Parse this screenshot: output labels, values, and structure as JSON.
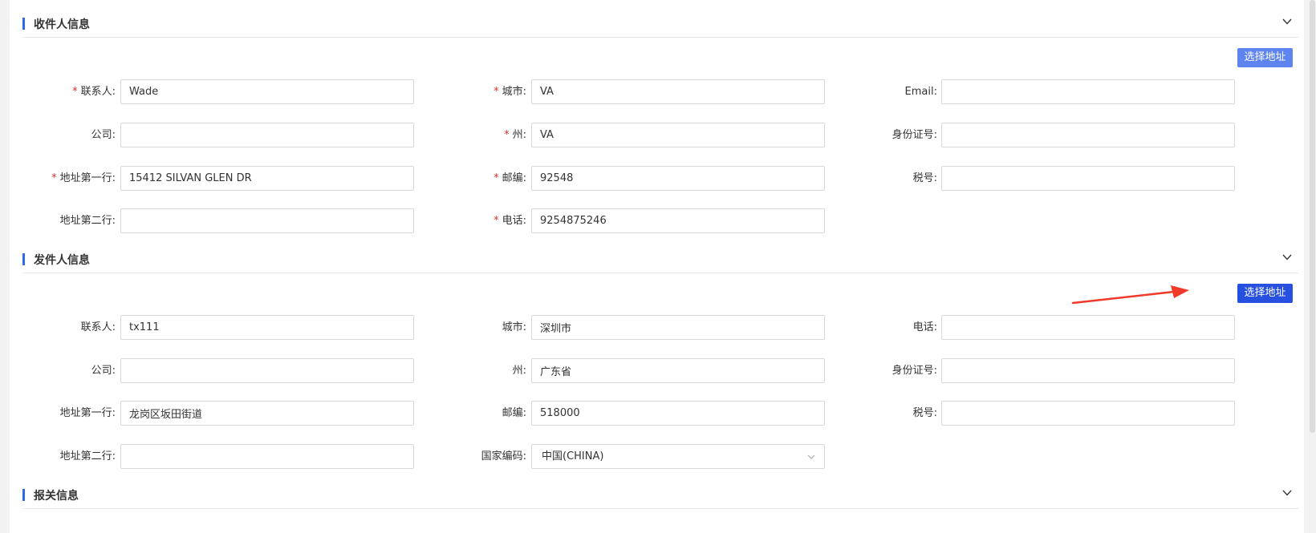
{
  "recipient": {
    "title": "收件人信息",
    "select_button": "选择地址",
    "fields": {
      "contact": {
        "label": "联系人",
        "value": "Wade",
        "required": true
      },
      "company": {
        "label": "公司",
        "value": "",
        "required": false
      },
      "address1": {
        "label": "地址第一行",
        "value": "15412 SILVAN GLEN DR",
        "required": true
      },
      "address2": {
        "label": "地址第二行",
        "value": "",
        "required": false
      },
      "city": {
        "label": "城市",
        "value": "VA",
        "required": true
      },
      "state": {
        "label": "州",
        "value": "VA",
        "required": true
      },
      "zip": {
        "label": "邮编",
        "value": "92548",
        "required": true
      },
      "phone": {
        "label": "电话",
        "value": "9254875246",
        "required": true
      },
      "email": {
        "label": "Email",
        "value": "",
        "required": false
      },
      "id_number": {
        "label": "身份证号",
        "value": "",
        "required": false
      },
      "tax_number": {
        "label": "税号",
        "value": "",
        "required": false
      }
    }
  },
  "sender": {
    "title": "发件人信息",
    "select_button": "选择地址",
    "fields": {
      "contact": {
        "label": "联系人",
        "value": "tx111"
      },
      "company": {
        "label": "公司",
        "value": ""
      },
      "address1": {
        "label": "地址第一行",
        "value": "龙岗区坂田街道"
      },
      "address2": {
        "label": "地址第二行",
        "value": ""
      },
      "city": {
        "label": "城市",
        "value": "深圳市"
      },
      "state": {
        "label": "州",
        "value": "广东省"
      },
      "zip": {
        "label": "邮编",
        "value": "518000"
      },
      "country_code": {
        "label": "国家编码",
        "value": "中国(CHINA)"
      },
      "phone": {
        "label": "电话",
        "value": ""
      },
      "id_number": {
        "label": "身份证号",
        "value": ""
      },
      "tax_number": {
        "label": "税号",
        "value": ""
      }
    }
  },
  "customs": {
    "title": "报关信息"
  },
  "colors": {
    "accent": "#2f6be8",
    "button_light": "#5e84f0",
    "button_dark": "#2750e0",
    "required_star": "#e62e2e",
    "annotation_arrow": "#f03a2a"
  },
  "icons": {
    "section_toggle": "chevron-down-icon",
    "select_caret": "chevron-down-icon",
    "annotation": "red-arrow-icon"
  }
}
